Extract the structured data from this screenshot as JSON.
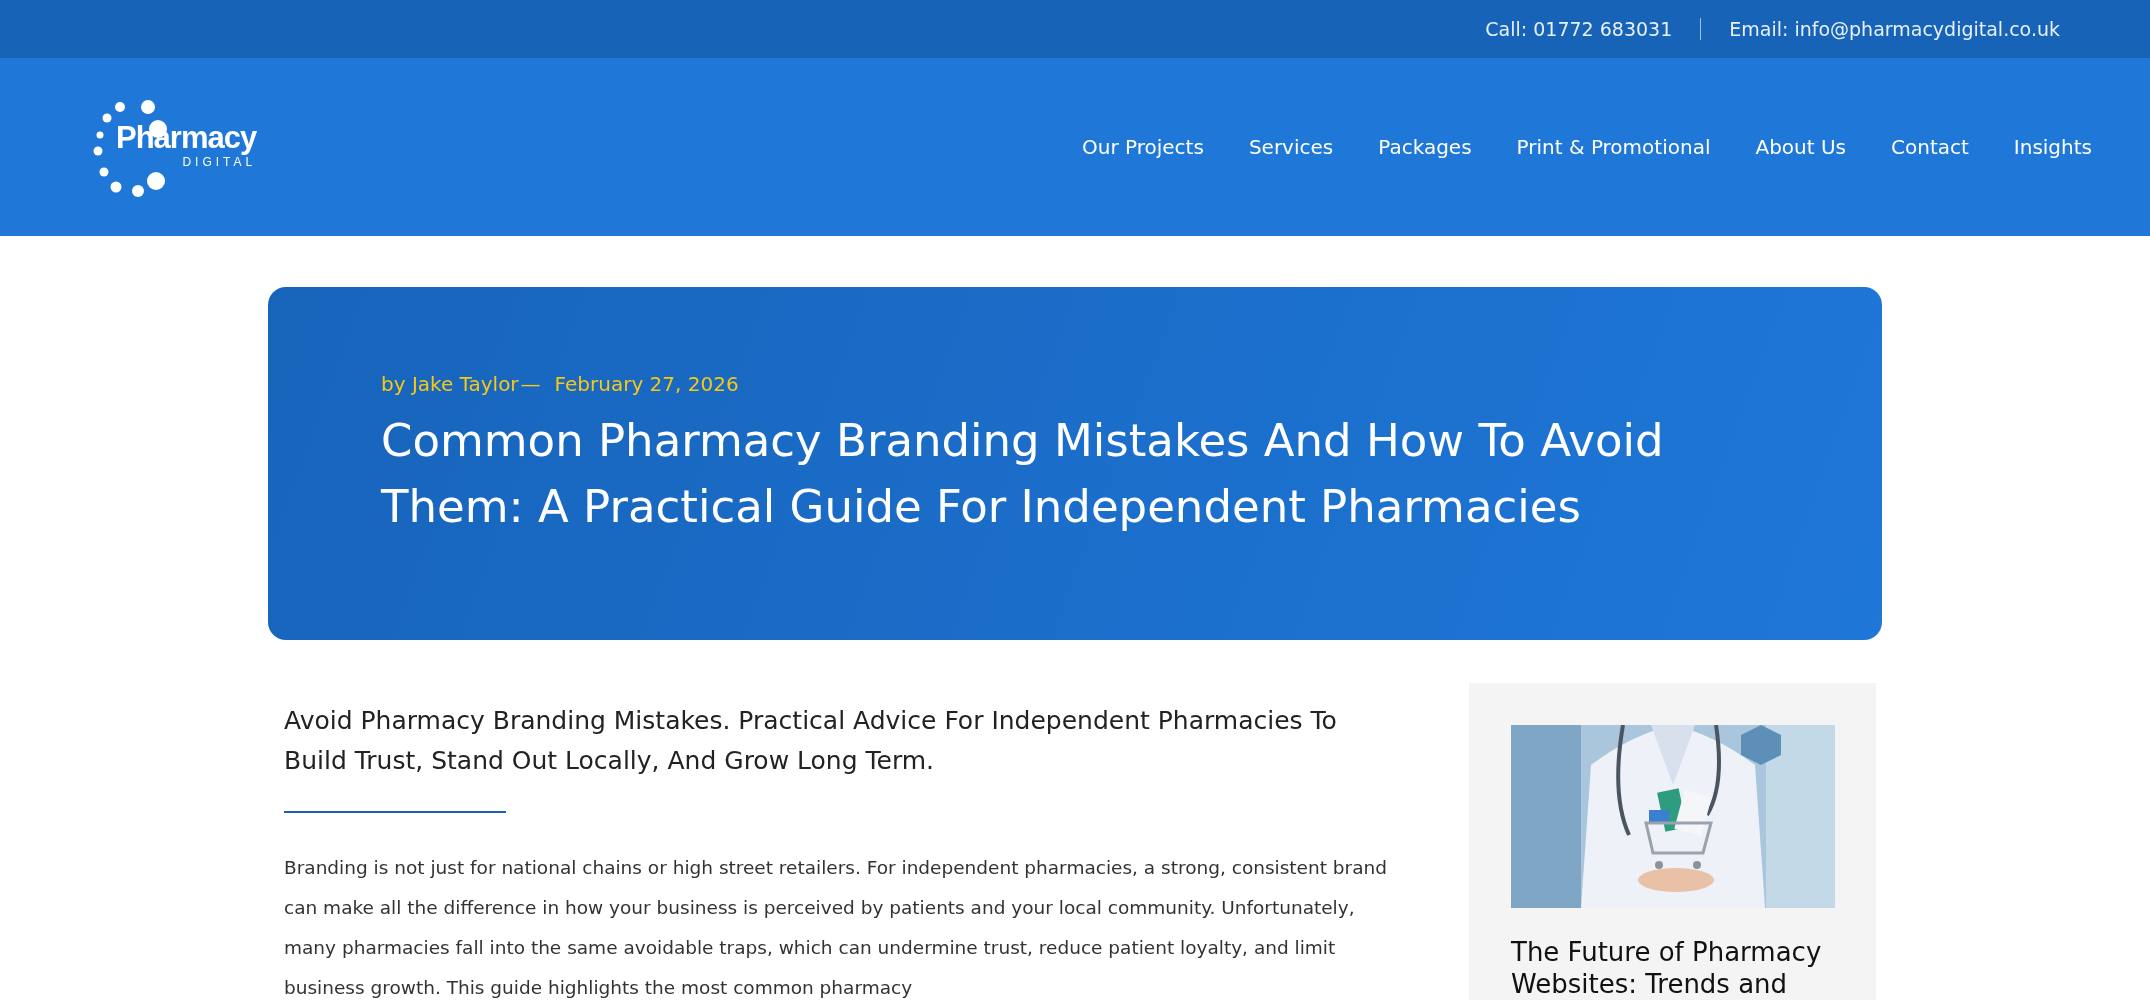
{
  "top_bar": {
    "phone": "Call: 01772 683031",
    "email": "Email: info@pharmacydigital.co.uk"
  },
  "logo": {
    "word": "Pharmacy",
    "sub": "DIGITAL"
  },
  "nav": [
    {
      "label": "Our Projects"
    },
    {
      "label": "Services"
    },
    {
      "label": "Packages"
    },
    {
      "label": "Print & Promotional"
    },
    {
      "label": "About Us"
    },
    {
      "label": "Contact"
    },
    {
      "label": "Insights"
    }
  ],
  "hero": {
    "author": "by Jake Taylor",
    "separator": "—",
    "date": "February 27, 2026",
    "title": "Common Pharmacy Branding Mistakes And How To Avoid Them: A Practical Guide For Independent Pharmacies"
  },
  "article": {
    "subtitle": "Avoid Pharmacy Branding Mistakes. Practical Advice For Independent Pharmacies To Build Trust, Stand Out Locally, And Grow Long Term.",
    "paragraph": "Branding is not just for national chains or high street retailers. For independent pharmacies, a strong, consistent brand can make all the difference in how your business is perceived by patients and your local community. Unfortunately, many pharmacies fall into the same avoidable traps, which can undermine trust, reduce patient loyalty, and limit business growth. This guide highlights the most common pharmacy"
  },
  "sidebar": {
    "posts": [
      {
        "kind": "picture",
        "title": "The Future of Pharmacy Websites: Trends and"
      }
    ]
  }
}
